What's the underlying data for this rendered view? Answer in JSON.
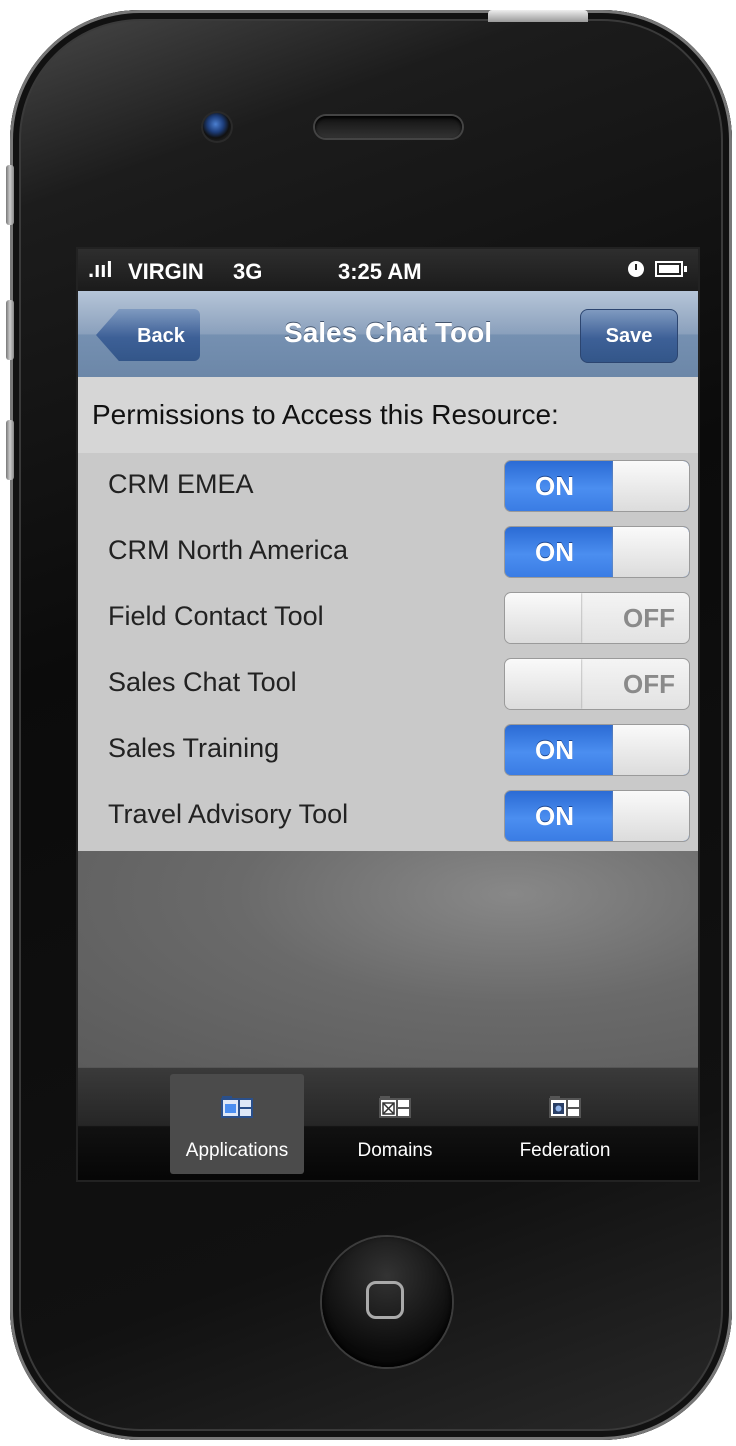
{
  "status_bar": {
    "signal": ".ııl",
    "carrier": "VIRGIN",
    "network": "3G",
    "time": "3:25 AM"
  },
  "nav_bar": {
    "back_label": "Back",
    "title": "Sales Chat Tool",
    "save_label": "Save"
  },
  "section": {
    "header": "Permissions to Access this Resource:"
  },
  "permissions": [
    {
      "label": "CRM EMEA",
      "state": "ON"
    },
    {
      "label": "CRM North America",
      "state": "ON"
    },
    {
      "label": "Field Contact Tool",
      "state": "OFF"
    },
    {
      "label": "Sales Chat Tool",
      "state": "OFF"
    },
    {
      "label": "Sales Training",
      "state": "ON"
    },
    {
      "label": "Travel Advisory Tool",
      "state": "ON"
    }
  ],
  "tab_bar": {
    "tabs": [
      {
        "label": "Applications",
        "icon": "applications-icon",
        "active": true
      },
      {
        "label": "Domains",
        "icon": "domains-icon",
        "active": false
      },
      {
        "label": "Federation",
        "icon": "federation-icon",
        "active": false
      }
    ]
  },
  "colors": {
    "nav_bar": "#8aa0bc",
    "switch_on": "#3a7ce4",
    "switch_off": "#e8e8e8",
    "section_header": "#d6d6d6",
    "list_bg": "#c9c9c9"
  }
}
